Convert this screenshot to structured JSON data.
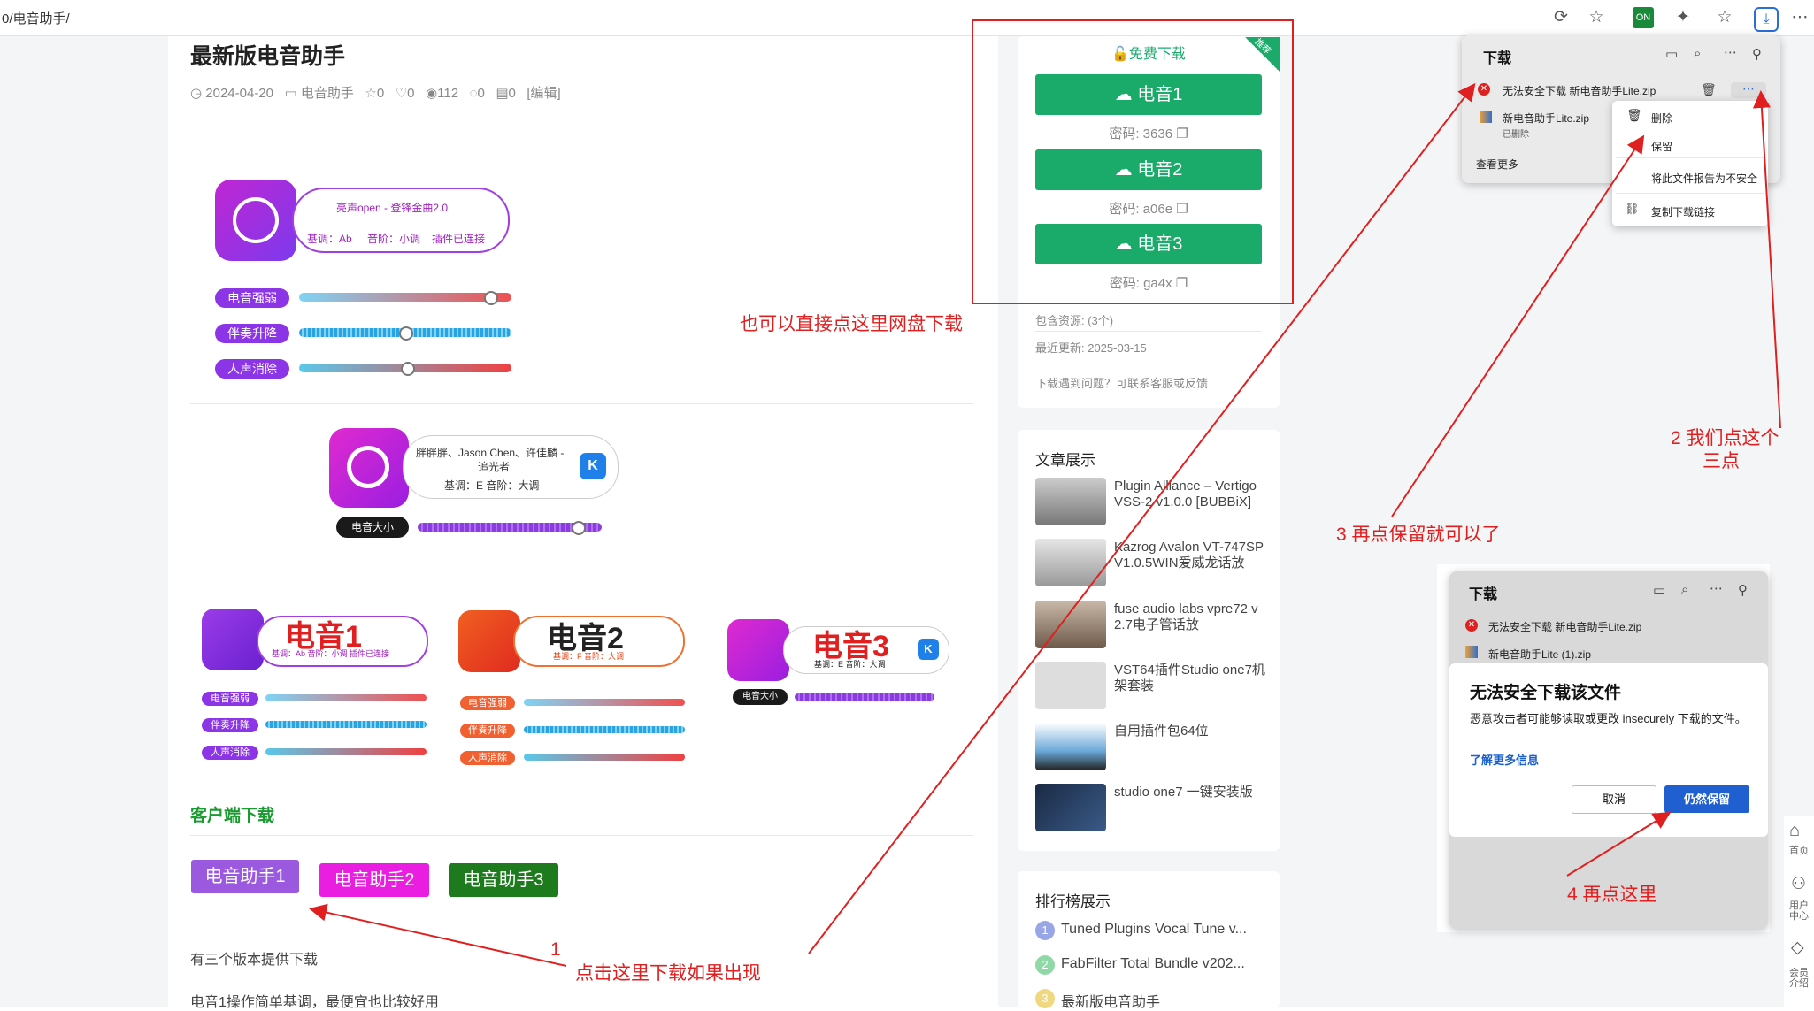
{
  "browser": {
    "url": "0/电音助手/"
  },
  "article": {
    "title": "最新版电音助手",
    "meta": {
      "date": "2024-04-20",
      "category": "电音助手",
      "stars": "0",
      "likes": "0",
      "views": "112",
      "comments": "0",
      "other": "0",
      "edit": "[编辑]"
    },
    "promo1": {
      "line1": "亮声open - 登锋金曲2.0",
      "line2_key": "基调：Ab",
      "line2_scale": "音阶：小调",
      "line2_status": "插件已连接",
      "sliders": [
        "电音强弱",
        "伴奏升降",
        "人声消除"
      ],
      "slider_levels": [
        0.95,
        0.5,
        0.5
      ]
    },
    "promo2": {
      "line1": "胖胖胖、Jason Chen、许佳麟 -",
      "line1b": "追光者",
      "line2": "基调：E  音阶：大调",
      "slider": "电音大小",
      "slider_level": 0.9
    },
    "promo_row": [
      {
        "name": "电音1",
        "sub": "基调：Ab  音阶：小调  插件已连接",
        "sliders": [
          "电音强弱",
          "伴奏升降",
          "人声消除"
        ]
      },
      {
        "name": "电音2",
        "sub": "基调：F  音阶：大调",
        "sliders": [
          "电音强弱",
          "伴奏升降",
          "人声消除"
        ]
      },
      {
        "name": "电音3",
        "sub": "基调：E  音阶：大调",
        "sliders": [
          "电音大小"
        ]
      }
    ],
    "client_heading": "客户端下载",
    "client_buttons": [
      "电音助手1",
      "电音助手2",
      "电音助手3"
    ],
    "client_button_colors": [
      "#9b59e0",
      "#e91ee0",
      "#1d7a1d"
    ],
    "para1": "有三个版本提供下载",
    "para2": "电音1操作简单基调，最便宜也比较好用"
  },
  "annotations": {
    "a_direct": "也可以直接点这里网盘下载",
    "a1_num": "1",
    "a1_text": "点击这里下载如果出现",
    "a2": "2  我们点这个",
    "a2b": "三点",
    "a3": "3    再点保留就可以了",
    "a4": "4 再点这里",
    "color": "#e02020"
  },
  "download_card": {
    "free": "免费下载",
    "corner": "推荐",
    "buttons": [
      {
        "label": "电音1",
        "password": "密码: 3636"
      },
      {
        "label": "电音2",
        "password": "密码: a06e"
      },
      {
        "label": "电音3",
        "password": "密码: ga4x"
      }
    ],
    "resources": "包含资源: (3个)",
    "updated": "最近更新: 2025-03-15",
    "help": "下载遇到问题？可联系客服或反馈",
    "accent": "#1aab6b"
  },
  "articles_card": {
    "title": "文章展示",
    "items": [
      "Plugin Alliance – Vertigo VSS-2 v1.0.0 [BUBBiX]",
      "Kazrog Avalon VT-747SP V1.0.5WIN爱威龙话放",
      "fuse audio labs vpre72 v 2.7电子管话放",
      "VST64插件Studio one7机架套装",
      "自用插件包64位",
      "studio one7 一键安装版"
    ]
  },
  "rank_card": {
    "title": "排行榜展示",
    "items": [
      {
        "num": "1",
        "text": "Tuned Plugins Vocal Tune v..."
      },
      {
        "num": "2",
        "text": "FabFilter Total Bundle v202..."
      },
      {
        "num": "3",
        "text": "最新版电音助手"
      }
    ]
  },
  "downloads_panel": {
    "title": "下载",
    "item1": "无法安全下载 新电音助手Lite.zip",
    "item2": "新电音助手Lite.zip",
    "item2_sub": "已删除",
    "see_more": "查看更多",
    "menu": [
      "删除",
      "保留",
      "将此文件报告为不安全",
      "复制下载链接"
    ]
  },
  "downloads_panel2": {
    "title": "下载",
    "item1": "无法安全下载 新电音助手Lite.zip",
    "item2": "新电音助手Lite (1).zip",
    "dialog_title": "无法安全下载该文件",
    "dialog_body": "恶意攻击者可能够读取或更改 insecurely 下载的文件。",
    "learn_more": "了解更多信息",
    "cancel": "取消",
    "keep": "仍然保留"
  },
  "right_rail": [
    {
      "icon": "home-icon",
      "label": "首页"
    },
    {
      "icon": "user-icon",
      "label": "用户中心"
    },
    {
      "icon": "diamond-icon",
      "label": "会员介绍"
    }
  ]
}
